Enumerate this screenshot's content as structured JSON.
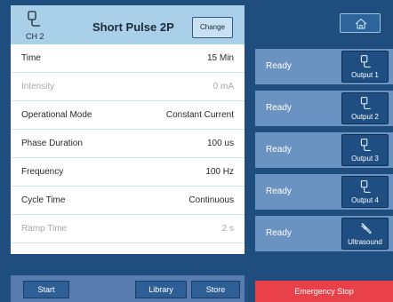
{
  "header": {
    "channel_label": "CH 2",
    "program_name": "Short Pulse 2P",
    "change_label": "Change"
  },
  "params": [
    {
      "label": "Time",
      "value": "15 Min",
      "enabled": true
    },
    {
      "label": "Intensity",
      "value": "0 mA",
      "enabled": false
    },
    {
      "label": "Operational Mode",
      "value": "Constant Current",
      "enabled": true
    },
    {
      "label": "Phase Duration",
      "value": "100 us",
      "enabled": true
    },
    {
      "label": "Frequency",
      "value": "100 Hz",
      "enabled": true
    },
    {
      "label": "Cycle Time",
      "value": "Continuous",
      "enabled": true
    },
    {
      "label": "Ramp Time",
      "value": "2 s",
      "enabled": false
    }
  ],
  "outputs": [
    {
      "status": "Ready",
      "label": "Output 1",
      "icon": "electrode-icon"
    },
    {
      "status": "Ready",
      "label": "Output 2",
      "icon": "electrode-icon"
    },
    {
      "status": "Ready",
      "label": "Output 3",
      "icon": "electrode-icon"
    },
    {
      "status": "Ready",
      "label": "Output 4",
      "icon": "electrode-icon"
    },
    {
      "status": "Ready",
      "label": "Ultrasound",
      "icon": "ultrasound-probe-icon"
    }
  ],
  "bottom": {
    "start_label": "Start",
    "library_label": "Library",
    "store_label": "Store",
    "emergency_label": "Emergency Stop"
  },
  "icons": {
    "home": "home-icon"
  },
  "colors": {
    "background": "#1f4d7e",
    "header": "#a9cfe9",
    "output_row": "#6b93c2",
    "output_button": "#1f4f82",
    "emergency": "#e8414a"
  }
}
